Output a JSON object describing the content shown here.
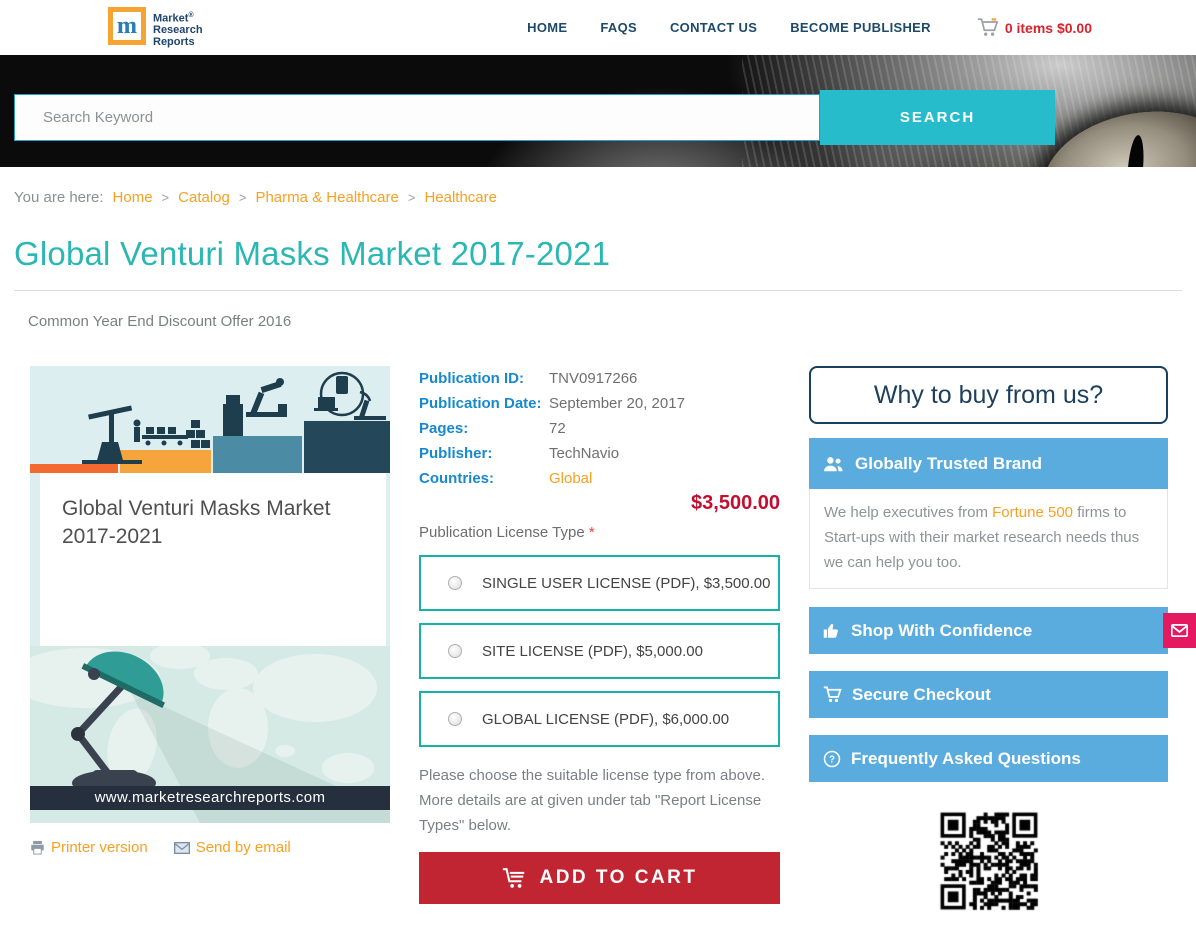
{
  "header": {
    "logo": {
      "mark": "m",
      "line1": "Market",
      "registered": "®",
      "line2": "Research",
      "line3": "Reports"
    },
    "nav": [
      {
        "label": "HOME"
      },
      {
        "label": "FAQS"
      },
      {
        "label": "CONTACT US"
      },
      {
        "label": "BECOME PUBLISHER"
      }
    ],
    "cart_status": "0 items $0.00"
  },
  "search": {
    "placeholder": "Search Keyword",
    "button": "SEARCH"
  },
  "breadcrumb": {
    "prefix": "You are here:",
    "separator": ">",
    "items": [
      "Home",
      "Catalog",
      "Pharma & Healthcare",
      "Healthcare"
    ]
  },
  "page": {
    "title": "Global Venturi Masks Market 2017-2021",
    "offer": "Common Year End Discount Offer 2016"
  },
  "product_card": {
    "cover_title": "Global Venturi Masks Market 2017-2021",
    "website": "www.marketresearchreports.com"
  },
  "product_links": {
    "printer": "Printer version",
    "email": "Send by email"
  },
  "details": {
    "rows": [
      {
        "label": "Publication ID:",
        "value": "TNV0917266"
      },
      {
        "label": "Publication Date:",
        "value": "September 20, 2017"
      },
      {
        "label": "Pages:",
        "value": "72"
      },
      {
        "label": "Publisher:",
        "value": "TechNavio"
      },
      {
        "label": "Countries:",
        "value": "Global"
      }
    ],
    "price": "$3,500.00"
  },
  "license": {
    "label": "Publication License Type",
    "required": "*",
    "options": [
      {
        "label": "SINGLE USER LICENSE (PDF), $3,500.00"
      },
      {
        "label": "SITE LICENSE (PDF), $5,000.00"
      },
      {
        "label": "GLOBAL LICENSE (PDF), $6,000.00"
      }
    ],
    "note": "Please choose the suitable license type from above. More details are at given under tab \"Report License Types\" below."
  },
  "cart_button": "ADD TO CART",
  "sidebar": {
    "why_title": "Why to buy from us?",
    "trusted": {
      "title": "Globally Trusted Brand",
      "text_before": "We help executives from ",
      "highlight": "Fortune 500",
      "text_after": " firms to Start-ups with their market research needs thus we can help you too."
    },
    "bars": [
      {
        "label": "Shop With Confidence"
      },
      {
        "label": "Secure Checkout"
      },
      {
        "label": "Frequently Asked Questions"
      }
    ]
  },
  "colors": {
    "teal_title": "#2bb7b3",
    "navy_nav": "#1d4a6a",
    "orange_link": "#f9a021",
    "blue_label": "#1789cc",
    "red_price": "#c30e2f",
    "red_button": "#c22532",
    "sidebar_blue": "#5aabde",
    "license_border": "#15b2a5",
    "search_teal": "#27bccb",
    "pink_tab": "#e5195f"
  }
}
